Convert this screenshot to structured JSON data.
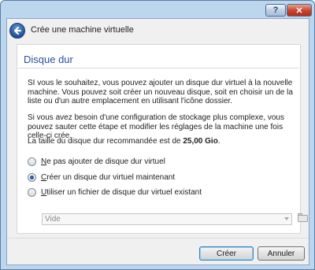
{
  "window": {
    "help_label": "?",
    "close_label": "✕"
  },
  "header": {
    "title": "Crée une machine virtuelle",
    "back_icon": "arrow-left-icon"
  },
  "page": {
    "title": "Disque dur",
    "para1": "SI vous le souhaitez, vous pouvez ajouter un disque dur virtuel à la nouvelle machine. Vous pouvez soit créer un nouveau disque, soit en choisir un de la liste ou d'un autre emplacement en utilisant l'icône dossier.",
    "para2": "Si vous avez besoin d'une configuration de stockage plus complexe, vous pouvez sauter cette étape et modifier les réglages de la machine une fois celle-ci crée.",
    "para3_prefix": "La taille du disque dur recommandée est de ",
    "para3_size": "25,00 Gio",
    "para3_suffix": "."
  },
  "options": [
    {
      "mnemonic": "N",
      "rest": "e pas ajouter de disque dur virtuel",
      "checked": false
    },
    {
      "mnemonic": "C",
      "rest": "réer un disque dur virtuel maintenant",
      "checked": true
    },
    {
      "mnemonic": "U",
      "rest": "tiliser un fichier de disque dur virtuel existant",
      "checked": false
    }
  ],
  "disk_select": {
    "value": "Vide",
    "enabled": false
  },
  "folder_icon": "folder-browse-icon",
  "buttons": {
    "create": "Créer",
    "cancel": "Annuler"
  },
  "colors": {
    "title_blue": "#2a4fa0",
    "frame_blue": "#bcd6ee",
    "close_red": "#c8412b"
  }
}
